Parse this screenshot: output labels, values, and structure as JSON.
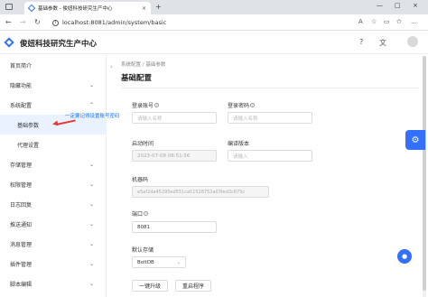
{
  "browser": {
    "tab_title": "基础参数 - 俊妞科技研究生产中心",
    "tab_close": "×",
    "new_tab": "+",
    "url": "localhost:8081/admin/system/basic",
    "window_controls": [
      "—",
      "□",
      "×"
    ]
  },
  "app": {
    "name": "俊妞科技研究生产中心"
  },
  "sidebar": {
    "items": [
      {
        "label": "首页简介"
      },
      {
        "label": "隐藏功能",
        "chevron": "⌄"
      },
      {
        "label": "系统配置",
        "chevron": "⌃"
      },
      {
        "label": "基础参数",
        "active": true
      },
      {
        "label": "代理设置"
      },
      {
        "label": "存储管理",
        "chevron": "⌄"
      },
      {
        "label": "权限管理",
        "chevron": "⌄"
      },
      {
        "label": "日志回复",
        "chevron": "⌄"
      },
      {
        "label": "推送通知",
        "chevron": "⌄"
      },
      {
        "label": "消息管理",
        "chevron": "⌄"
      },
      {
        "label": "插件管理",
        "chevron": "⌄"
      },
      {
        "label": "脚本编辑",
        "chevron": "⌄"
      }
    ]
  },
  "annotation": {
    "text": "一定要记得设置账号密码"
  },
  "breadcrumb": {
    "items": [
      "系统配置",
      "/",
      "基础参数"
    ]
  },
  "page": {
    "title": "基础配置"
  },
  "form": {
    "account": {
      "label": "登录账号",
      "placeholder": "请输入名称"
    },
    "password": {
      "label": "登录密码",
      "placeholder": "请输入名称"
    },
    "start_time": {
      "label": "启动时间",
      "value": "2023-07-08 08:51:56"
    },
    "version": {
      "label": "编译版本",
      "placeholder": "请输入"
    },
    "machine_code": {
      "label": "机器码",
      "value": "e5af2da45295ed551ca51528752a03fed3c675c"
    },
    "port": {
      "label": "端口",
      "value": "8081"
    },
    "storage": {
      "label": "默认存储",
      "value": "BoltDB",
      "dropdown": "⌄"
    }
  },
  "buttons": {
    "upgrade": "一键升级",
    "restart": "重启程序"
  },
  "colors": {
    "primary": "#3370ff",
    "annotation_arrow": "#e53935",
    "annotation_text": "#1677ff"
  }
}
